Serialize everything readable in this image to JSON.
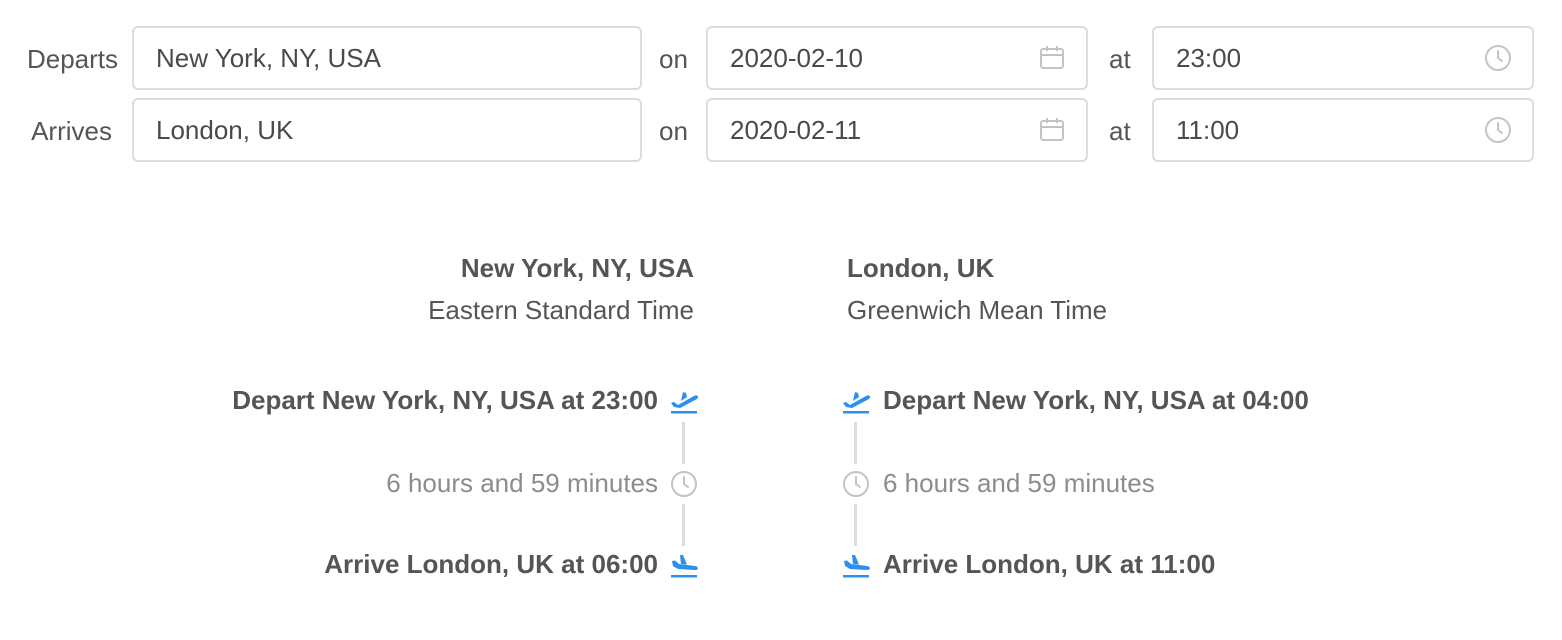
{
  "form": {
    "departs": {
      "label": "Departs",
      "location": "New York, NY, USA",
      "on_label": "on",
      "date": "2020-02-10",
      "at_label": "at",
      "time": "23:00"
    },
    "arrives": {
      "label": "Arrives",
      "location": "London, UK",
      "on_label": "on",
      "date": "2020-02-11",
      "at_label": "at",
      "time": "11:00"
    }
  },
  "zones": {
    "origin": {
      "name": "New York, NY, USA",
      "description": "Eastern Standard Time"
    },
    "destination": {
      "name": "London, UK",
      "description": "Greenwich Mean Time"
    }
  },
  "timelines": {
    "origin": {
      "depart": "Depart New York, NY, USA at 23:00",
      "duration": "6 hours and 59 minutes",
      "arrive": "Arrive London, UK at 06:00"
    },
    "destination": {
      "depart": "Depart New York, NY, USA at 04:00",
      "duration": "6 hours and 59 minutes",
      "arrive": "Arrive London, UK at 11:00"
    }
  },
  "icons": {
    "calendar": "calendar-icon",
    "clock": "clock-icon",
    "takeoff": "plane-takeoff-icon",
    "landing": "plane-landing-icon"
  },
  "colors": {
    "accent": "#2b8ff0",
    "icon_gray": "#c4c4c4",
    "muted_text": "#8c8c8c",
    "connector": "#dddddd"
  }
}
